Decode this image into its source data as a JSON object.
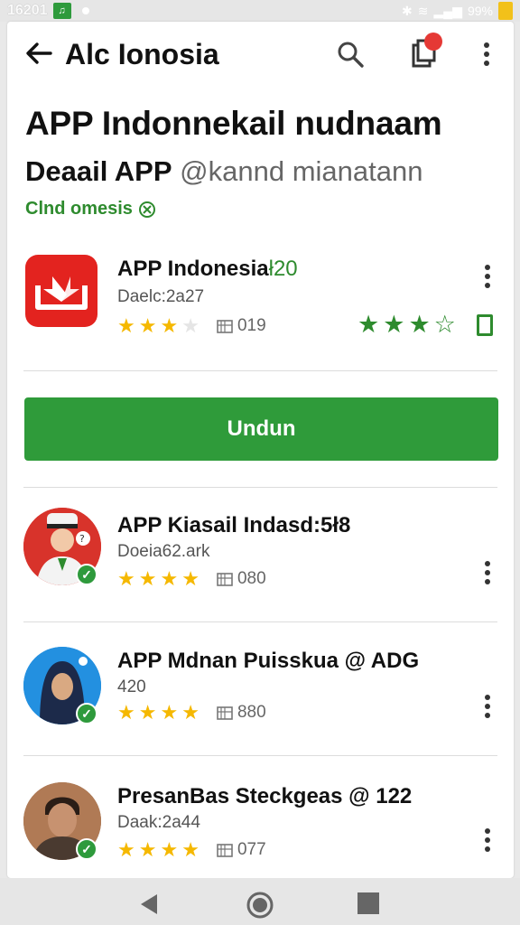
{
  "status_bar": {
    "time": "16201",
    "battery": "99%"
  },
  "app_bar": {
    "title": "Alc Ionosia"
  },
  "header": {
    "title": "APP Indonnekail nudnaam",
    "subtitle_bold": "Deaail APP",
    "subtitle_handle": "@kannd mianatann",
    "tag": "Clnd omesis"
  },
  "main_app": {
    "name": "APP Indonesia",
    "name_suffix": "ł20",
    "meta": "Daelc:2a27",
    "rating_stars": 3,
    "downloads": "019",
    "install_label": "Undun",
    "brand_color": "#e3231f",
    "accent_color": "#2f9b3a"
  },
  "list": [
    {
      "name": "APP Kiasail Indasd:5ł8",
      "meta": "Doeia62.ark",
      "rating_stars": 4,
      "downloads": "080"
    },
    {
      "name": "APP Mdnan Puisskua @ ADG",
      "meta": "420",
      "rating_stars": 4,
      "downloads": "880"
    },
    {
      "name": "PresanBas Steckgeas @ 122",
      "meta": "Daak:2a44",
      "rating_stars": 4,
      "downloads": "077"
    }
  ],
  "icons": [
    "back-arrow-icon",
    "search-icon",
    "share-icon",
    "more-vert-icon",
    "download-icon",
    "bookmark-icon",
    "verified-icon",
    "nav-back-icon",
    "nav-home-icon",
    "nav-recents-icon"
  ]
}
